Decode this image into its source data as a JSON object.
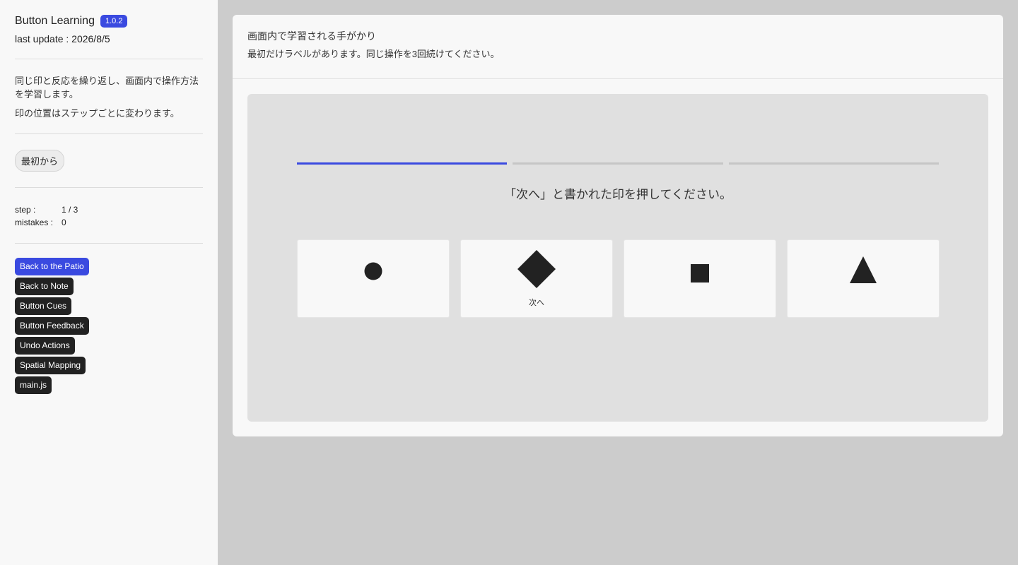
{
  "sidebar": {
    "app_title": "Button Learning",
    "version": "1.0.2",
    "last_update": "last update : 2026/8/5",
    "description": [
      "同じ印と反応を繰り返し、画面内で操作方法を学習します。",
      "印の位置はステップごとに変わります。"
    ],
    "reset_label": "最初から",
    "stats": {
      "step_label": "step :",
      "step_value": "1 / 3",
      "mistakes_label": "mistakes :",
      "mistakes_value": "0"
    },
    "links": [
      "Back to the Patio",
      "Back to Note",
      "Button Cues",
      "Button Feedback",
      "Undo Actions",
      "Spatial Mapping",
      "main.js"
    ]
  },
  "card": {
    "title": "画面内で学習される手がかり",
    "subtitle": "最初だけラベルがあります。同じ操作を3回続けてください。"
  },
  "task": {
    "progress": {
      "completed": 1,
      "total": 3
    },
    "instruction": "「次へ」と書かれた印を押してください。",
    "options": [
      {
        "shape": "circle",
        "label": ""
      },
      {
        "shape": "diamond",
        "label": "次へ"
      },
      {
        "shape": "square",
        "label": ""
      },
      {
        "shape": "triangle",
        "label": ""
      }
    ]
  },
  "colors": {
    "accent": "#3a4ae0",
    "dark": "#222222"
  }
}
